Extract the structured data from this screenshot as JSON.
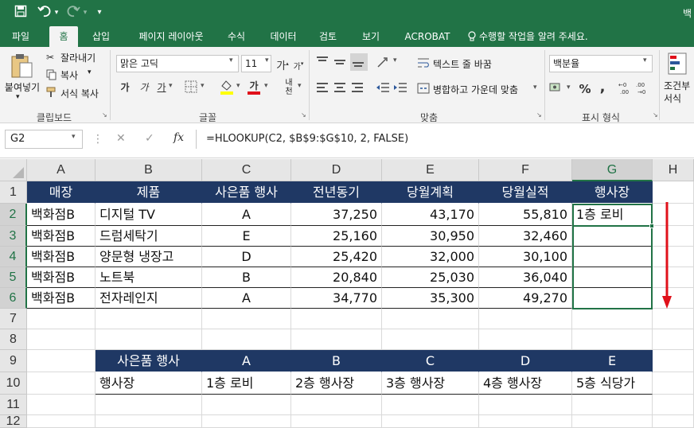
{
  "window": {
    "title_clip": "백"
  },
  "quick_access": {
    "save_icon": "save-icon",
    "undo_icon": "undo-icon",
    "redo_icon": "redo-icon",
    "customize_icon": "customize-icon"
  },
  "tabs": [
    "파일",
    "홈",
    "삽입",
    "페이지 레이아웃",
    "수식",
    "데이터",
    "검토",
    "보기",
    "ACROBAT",
    "수행할 작업을 알려 주세요."
  ],
  "active_tab": "홈",
  "ribbon": {
    "clipboard": {
      "paste": "붙여넣기",
      "cut": "잘라내기",
      "copy": "복사",
      "format_painter": "서식 복사",
      "label": "클립보드"
    },
    "font": {
      "font_name": "맑은 고딕",
      "font_size": "11",
      "bold": "가",
      "italic": "가",
      "underline": "가",
      "grow": "가",
      "shrink": "가",
      "font_color": "가",
      "phonetic": "내천",
      "label": "글꼴"
    },
    "alignment": {
      "wrap": "텍스트 줄 바꿈",
      "merge": "병합하고 가운데 맞춤",
      "label": "맞춤"
    },
    "number": {
      "format": "백분율",
      "percent": "%",
      "comma": ",",
      "label": "표시 형식"
    },
    "styles": {
      "conditional_line1": "조건부",
      "conditional_line2": "서식"
    }
  },
  "formula_bar": {
    "name_box": "G2",
    "cancel": "✕",
    "enter": "✓",
    "fx": "fx",
    "formula": "=HLOOKUP(C2, $B$9:$G$10, 2, FALSE)"
  },
  "columns": [
    "A",
    "B",
    "C",
    "D",
    "E",
    "F",
    "G",
    "H"
  ],
  "rows": [
    "1",
    "2",
    "3",
    "4",
    "5",
    "6",
    "7",
    "8",
    "9",
    "10",
    "11",
    "12"
  ],
  "table1": {
    "headers": [
      "매장",
      "제품",
      "사은품 행사",
      "전년동기",
      "당월계획",
      "당월실적",
      "행사장"
    ],
    "rows": [
      [
        "백화점B",
        "디지털 TV",
        "A",
        "37,250",
        "43,170",
        "55,810",
        "1층 로비"
      ],
      [
        "백화점B",
        "드럼세탁기",
        "E",
        "25,160",
        "30,950",
        "32,460",
        ""
      ],
      [
        "백화점B",
        "양문형 냉장고",
        "D",
        "25,420",
        "32,000",
        "30,100",
        ""
      ],
      [
        "백화점B",
        "노트북",
        "B",
        "20,840",
        "25,030",
        "36,040",
        ""
      ],
      [
        "백화점B",
        "전자레인지",
        "A",
        "34,770",
        "35,300",
        "49,270",
        ""
      ]
    ]
  },
  "table2": {
    "header": [
      "사은품 행사",
      "A",
      "B",
      "C",
      "D",
      "E"
    ],
    "values": [
      "행사장",
      "1층 로비",
      "2층 행사장",
      "3층 행사장",
      "4층 행사장",
      "5층 식당가"
    ]
  },
  "colors": {
    "excel_green": "#217346",
    "table_header": "#1f3864",
    "fill_arrow": "#e0101a"
  }
}
